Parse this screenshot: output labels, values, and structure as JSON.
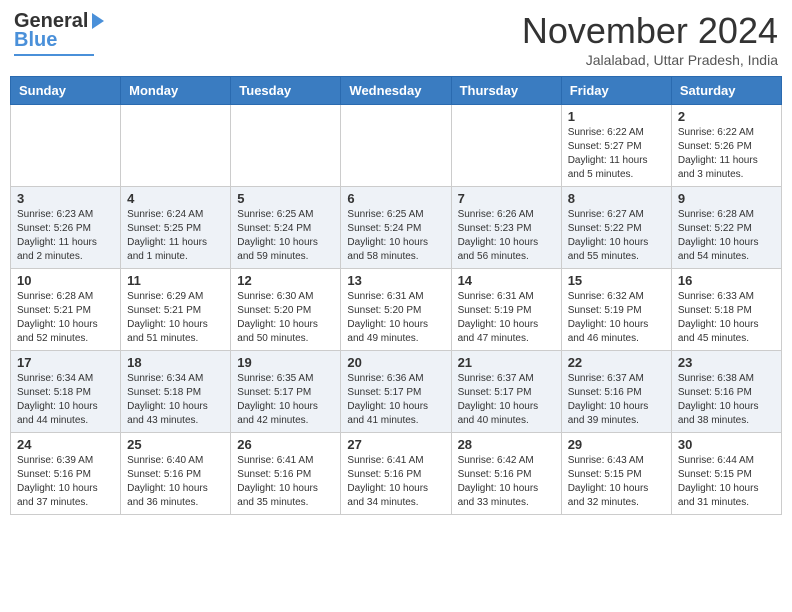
{
  "header": {
    "logo_line1": "General",
    "logo_line2": "Blue",
    "month_title": "November 2024",
    "subtitle": "Jalalabad, Uttar Pradesh, India"
  },
  "weekdays": [
    "Sunday",
    "Monday",
    "Tuesday",
    "Wednesday",
    "Thursday",
    "Friday",
    "Saturday"
  ],
  "weeks": [
    [
      {
        "day": "",
        "info": ""
      },
      {
        "day": "",
        "info": ""
      },
      {
        "day": "",
        "info": ""
      },
      {
        "day": "",
        "info": ""
      },
      {
        "day": "",
        "info": ""
      },
      {
        "day": "1",
        "info": "Sunrise: 6:22 AM\nSunset: 5:27 PM\nDaylight: 11 hours\nand 5 minutes."
      },
      {
        "day": "2",
        "info": "Sunrise: 6:22 AM\nSunset: 5:26 PM\nDaylight: 11 hours\nand 3 minutes."
      }
    ],
    [
      {
        "day": "3",
        "info": "Sunrise: 6:23 AM\nSunset: 5:26 PM\nDaylight: 11 hours\nand 2 minutes."
      },
      {
        "day": "4",
        "info": "Sunrise: 6:24 AM\nSunset: 5:25 PM\nDaylight: 11 hours\nand 1 minute."
      },
      {
        "day": "5",
        "info": "Sunrise: 6:25 AM\nSunset: 5:24 PM\nDaylight: 10 hours\nand 59 minutes."
      },
      {
        "day": "6",
        "info": "Sunrise: 6:25 AM\nSunset: 5:24 PM\nDaylight: 10 hours\nand 58 minutes."
      },
      {
        "day": "7",
        "info": "Sunrise: 6:26 AM\nSunset: 5:23 PM\nDaylight: 10 hours\nand 56 minutes."
      },
      {
        "day": "8",
        "info": "Sunrise: 6:27 AM\nSunset: 5:22 PM\nDaylight: 10 hours\nand 55 minutes."
      },
      {
        "day": "9",
        "info": "Sunrise: 6:28 AM\nSunset: 5:22 PM\nDaylight: 10 hours\nand 54 minutes."
      }
    ],
    [
      {
        "day": "10",
        "info": "Sunrise: 6:28 AM\nSunset: 5:21 PM\nDaylight: 10 hours\nand 52 minutes."
      },
      {
        "day": "11",
        "info": "Sunrise: 6:29 AM\nSunset: 5:21 PM\nDaylight: 10 hours\nand 51 minutes."
      },
      {
        "day": "12",
        "info": "Sunrise: 6:30 AM\nSunset: 5:20 PM\nDaylight: 10 hours\nand 50 minutes."
      },
      {
        "day": "13",
        "info": "Sunrise: 6:31 AM\nSunset: 5:20 PM\nDaylight: 10 hours\nand 49 minutes."
      },
      {
        "day": "14",
        "info": "Sunrise: 6:31 AM\nSunset: 5:19 PM\nDaylight: 10 hours\nand 47 minutes."
      },
      {
        "day": "15",
        "info": "Sunrise: 6:32 AM\nSunset: 5:19 PM\nDaylight: 10 hours\nand 46 minutes."
      },
      {
        "day": "16",
        "info": "Sunrise: 6:33 AM\nSunset: 5:18 PM\nDaylight: 10 hours\nand 45 minutes."
      }
    ],
    [
      {
        "day": "17",
        "info": "Sunrise: 6:34 AM\nSunset: 5:18 PM\nDaylight: 10 hours\nand 44 minutes."
      },
      {
        "day": "18",
        "info": "Sunrise: 6:34 AM\nSunset: 5:18 PM\nDaylight: 10 hours\nand 43 minutes."
      },
      {
        "day": "19",
        "info": "Sunrise: 6:35 AM\nSunset: 5:17 PM\nDaylight: 10 hours\nand 42 minutes."
      },
      {
        "day": "20",
        "info": "Sunrise: 6:36 AM\nSunset: 5:17 PM\nDaylight: 10 hours\nand 41 minutes."
      },
      {
        "day": "21",
        "info": "Sunrise: 6:37 AM\nSunset: 5:17 PM\nDaylight: 10 hours\nand 40 minutes."
      },
      {
        "day": "22",
        "info": "Sunrise: 6:37 AM\nSunset: 5:16 PM\nDaylight: 10 hours\nand 39 minutes."
      },
      {
        "day": "23",
        "info": "Sunrise: 6:38 AM\nSunset: 5:16 PM\nDaylight: 10 hours\nand 38 minutes."
      }
    ],
    [
      {
        "day": "24",
        "info": "Sunrise: 6:39 AM\nSunset: 5:16 PM\nDaylight: 10 hours\nand 37 minutes."
      },
      {
        "day": "25",
        "info": "Sunrise: 6:40 AM\nSunset: 5:16 PM\nDaylight: 10 hours\nand 36 minutes."
      },
      {
        "day": "26",
        "info": "Sunrise: 6:41 AM\nSunset: 5:16 PM\nDaylight: 10 hours\nand 35 minutes."
      },
      {
        "day": "27",
        "info": "Sunrise: 6:41 AM\nSunset: 5:16 PM\nDaylight: 10 hours\nand 34 minutes."
      },
      {
        "day": "28",
        "info": "Sunrise: 6:42 AM\nSunset: 5:16 PM\nDaylight: 10 hours\nand 33 minutes."
      },
      {
        "day": "29",
        "info": "Sunrise: 6:43 AM\nSunset: 5:15 PM\nDaylight: 10 hours\nand 32 minutes."
      },
      {
        "day": "30",
        "info": "Sunrise: 6:44 AM\nSunset: 5:15 PM\nDaylight: 10 hours\nand 31 minutes."
      }
    ]
  ]
}
